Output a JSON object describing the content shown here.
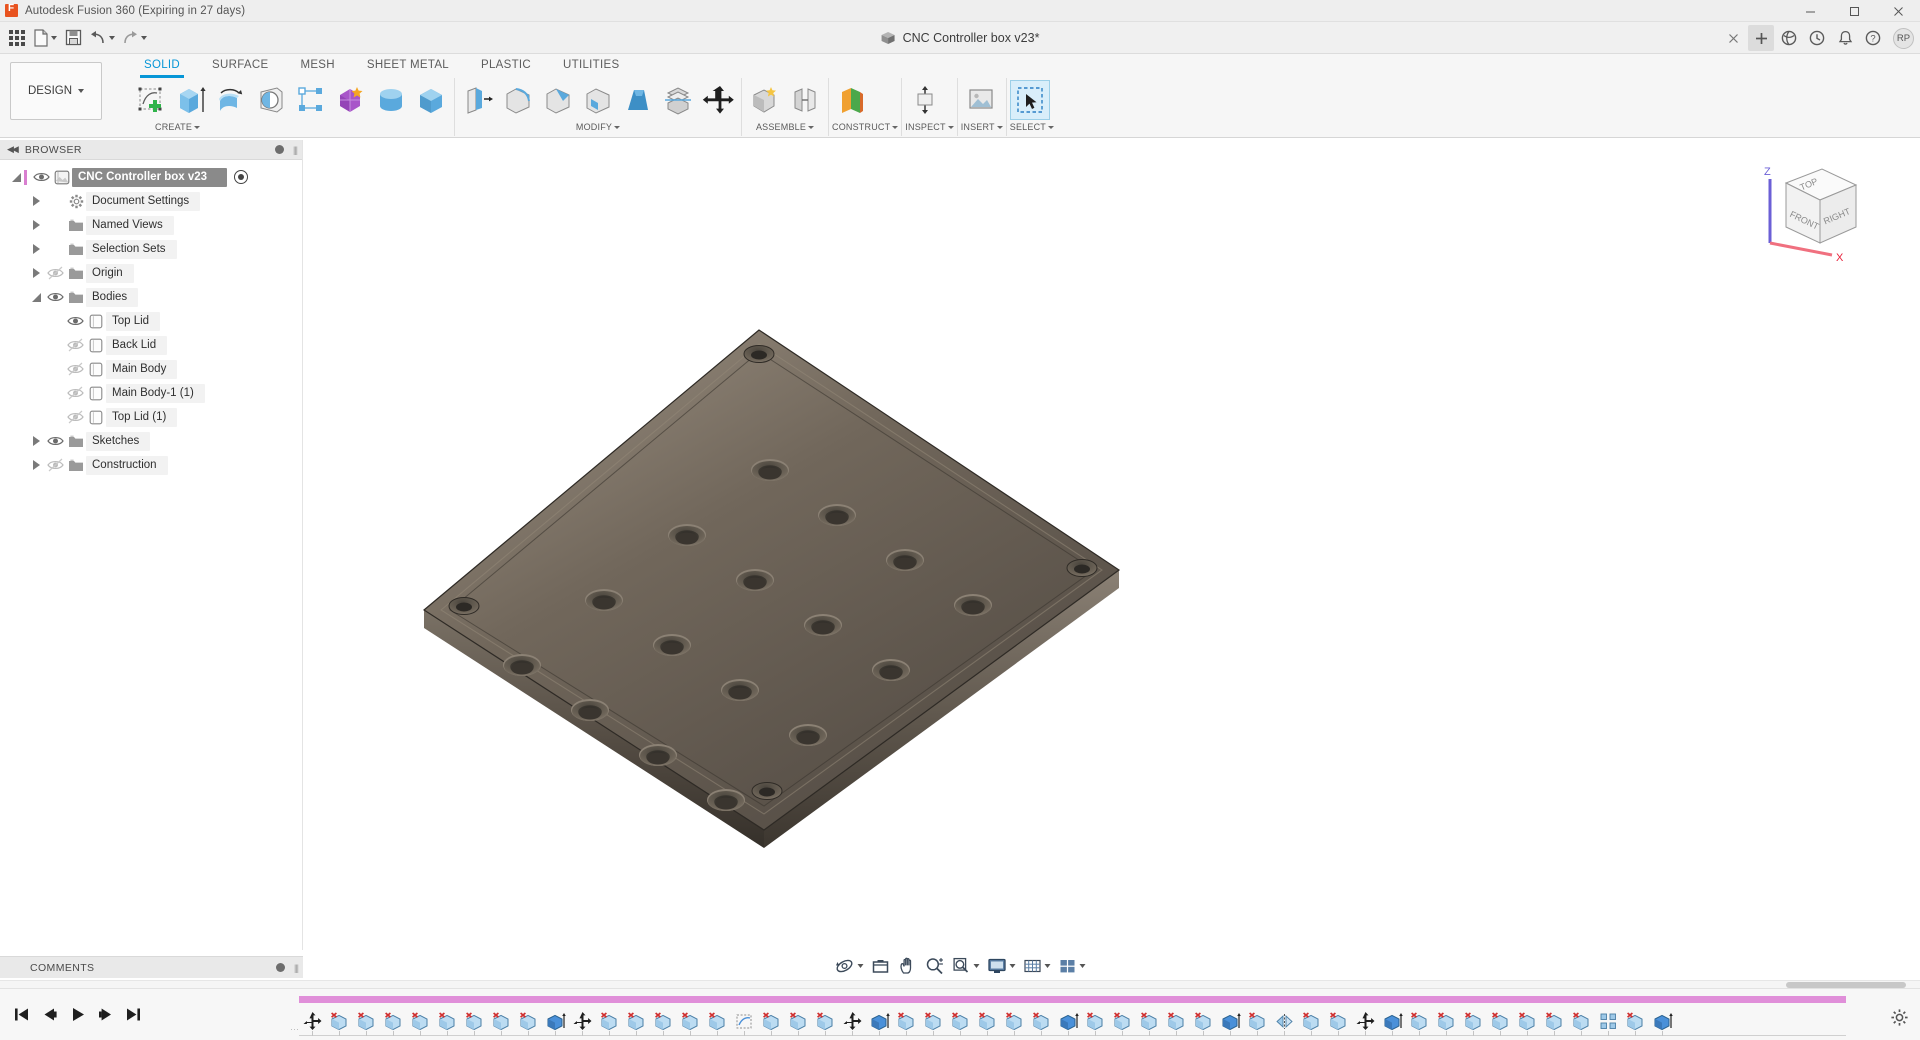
{
  "titlebar": {
    "app_title": "Autodesk Fusion 360 (Expiring in 27 days)",
    "logo_letter": "F",
    "minimize": "—",
    "maximize": "❐",
    "close": "✕"
  },
  "quick_access": {
    "items": [
      {
        "name": "app-grid-button",
        "label": ""
      },
      {
        "name": "file-menu-button",
        "label": ""
      },
      {
        "name": "save-button",
        "label": ""
      },
      {
        "name": "undo-button",
        "label": ""
      },
      {
        "name": "redo-button",
        "label": ""
      }
    ]
  },
  "document_tab": {
    "title": "CNC Controller box v23*",
    "close_label": "✕",
    "new_tab_label": "+"
  },
  "tab_right_icons": [
    {
      "name": "globe-icon",
      "glyph": "◔"
    },
    {
      "name": "clock-icon",
      "glyph": "◴"
    },
    {
      "name": "bell-icon",
      "glyph": "🔔"
    },
    {
      "name": "help-icon",
      "glyph": "?"
    }
  ],
  "user": {
    "initials": "RP"
  },
  "ribbon": {
    "workspace_label": "DESIGN",
    "tabs": [
      {
        "label": "SOLID",
        "active": true
      },
      {
        "label": "SURFACE",
        "active": false
      },
      {
        "label": "MESH",
        "active": false
      },
      {
        "label": "SHEET METAL",
        "active": false
      },
      {
        "label": "PLASTIC",
        "active": false
      },
      {
        "label": "UTILITIES",
        "active": false
      }
    ],
    "panels": [
      {
        "label": "CREATE",
        "has_caret": true,
        "tools": [
          {
            "name": "create-sketch-tool"
          },
          {
            "name": "extrude-tool"
          },
          {
            "name": "revolve-tool"
          },
          {
            "name": "sweep-tool"
          },
          {
            "name": "pattern-tool"
          },
          {
            "name": "form-tool"
          },
          {
            "name": "cylinder-primitive-tool"
          },
          {
            "name": "box-primitive-tool"
          }
        ]
      },
      {
        "label": "MODIFY",
        "has_caret": true,
        "tools": [
          {
            "name": "press-pull-tool"
          },
          {
            "name": "fillet-tool"
          },
          {
            "name": "chamfer-tool"
          },
          {
            "name": "shell-tool"
          },
          {
            "name": "draft-tool"
          },
          {
            "name": "split-body-tool"
          },
          {
            "name": "move-copy-tool"
          }
        ]
      },
      {
        "label": "ASSEMBLE",
        "has_caret": true,
        "tools": [
          {
            "name": "new-component-tool"
          },
          {
            "name": "joint-tool"
          }
        ]
      },
      {
        "label": "CONSTRUCT",
        "has_caret": true,
        "tools": [
          {
            "name": "construction-plane-tool"
          }
        ]
      },
      {
        "label": "INSPECT",
        "has_caret": true,
        "tools": [
          {
            "name": "measure-tool"
          }
        ]
      },
      {
        "label": "INSERT",
        "has_caret": true,
        "tools": [
          {
            "name": "insert-mcmaster-tool"
          }
        ]
      },
      {
        "label": "SELECT",
        "has_caret": true,
        "tools": [
          {
            "name": "select-tool"
          }
        ]
      }
    ]
  },
  "browser": {
    "header": "BROWSER",
    "tree": [
      {
        "label": "CNC Controller box v23",
        "level": 0,
        "expander": "down",
        "eye": "on",
        "icon": "component-icon",
        "root": true
      },
      {
        "label": "Document Settings",
        "level": 1,
        "expander": "right",
        "eye": "none",
        "icon": "gear-icon"
      },
      {
        "label": "Named Views",
        "level": 1,
        "expander": "right",
        "eye": "none",
        "icon": "folder-icon"
      },
      {
        "label": "Selection Sets",
        "level": 1,
        "expander": "right",
        "eye": "none",
        "icon": "folder-icon"
      },
      {
        "label": "Origin",
        "level": 1,
        "expander": "right",
        "eye": "off",
        "icon": "folder-icon"
      },
      {
        "label": "Bodies",
        "level": 1,
        "expander": "down",
        "eye": "on",
        "icon": "folder-icon"
      },
      {
        "label": "Top Lid",
        "level": 2,
        "expander": "none",
        "eye": "on",
        "icon": "body-icon"
      },
      {
        "label": "Back Lid",
        "level": 2,
        "expander": "none",
        "eye": "off",
        "icon": "body-icon"
      },
      {
        "label": "Main Body",
        "level": 2,
        "expander": "none",
        "eye": "off",
        "icon": "body-icon"
      },
      {
        "label": "Main Body-1 (1)",
        "level": 2,
        "expander": "none",
        "eye": "off",
        "icon": "body-icon"
      },
      {
        "label": "Top Lid (1)",
        "level": 2,
        "expander": "none",
        "eye": "off",
        "icon": "body-icon"
      },
      {
        "label": "Sketches",
        "level": 1,
        "expander": "right",
        "eye": "on",
        "icon": "folder-icon"
      },
      {
        "label": "Construction",
        "level": 1,
        "expander": "right",
        "eye": "off",
        "icon": "folder-icon"
      }
    ]
  },
  "viewcube": {
    "face_top": "TOP",
    "face_front": "FRONT",
    "face_right": "RIGHT",
    "axis_x": "X",
    "axis_z": "Z",
    "axis_x_color": "#e8223c",
    "axis_z_color": "#5b4fd0"
  },
  "comments": {
    "header": "COMMENTS"
  },
  "navbar": {
    "buttons": [
      {
        "name": "orbit-tool-button",
        "caret": true
      },
      {
        "name": "look-at-button",
        "caret": false
      },
      {
        "name": "pan-tool-button",
        "caret": false
      },
      {
        "name": "zoom-tool-button",
        "caret": false
      },
      {
        "name": "zoom-window-button",
        "caret": true
      },
      {
        "name": "display-settings-button",
        "caret": true
      },
      {
        "name": "grid-snaps-button",
        "caret": true
      },
      {
        "name": "viewport-layout-button",
        "caret": true
      }
    ]
  },
  "timeline": {
    "playback": [
      {
        "name": "go-to-beginning-button"
      },
      {
        "name": "step-back-button"
      },
      {
        "name": "play-button"
      },
      {
        "name": "step-forward-button"
      },
      {
        "name": "go-to-end-button"
      }
    ],
    "progress_color": "#e08fd9",
    "features": [
      {
        "name": "timeline-marker",
        "type": "marker"
      },
      {
        "name": "timeline-feature-extrude-cut",
        "type": "extrude-cut"
      },
      {
        "name": "timeline-feature-extrude-cut",
        "type": "extrude-cut"
      },
      {
        "name": "timeline-feature-extrude-cut",
        "type": "extrude-cut"
      },
      {
        "name": "timeline-feature-extrude-cut",
        "type": "extrude-cut"
      },
      {
        "name": "timeline-feature-extrude-cut",
        "type": "extrude-cut"
      },
      {
        "name": "timeline-feature-extrude-cut",
        "type": "extrude-cut"
      },
      {
        "name": "timeline-feature-extrude-cut",
        "type": "extrude-cut"
      },
      {
        "name": "timeline-feature-extrude-cut",
        "type": "extrude-cut"
      },
      {
        "name": "timeline-feature-extrude",
        "type": "extrude"
      },
      {
        "name": "timeline-feature-move",
        "type": "move"
      },
      {
        "name": "timeline-feature-extrude-cut",
        "type": "extrude-cut"
      },
      {
        "name": "timeline-feature-extrude-cut",
        "type": "extrude-cut"
      },
      {
        "name": "timeline-feature-extrude-cut",
        "type": "extrude-cut"
      },
      {
        "name": "timeline-feature-extrude-cut",
        "type": "extrude-cut"
      },
      {
        "name": "timeline-feature-extrude-cut",
        "type": "extrude-cut"
      },
      {
        "name": "timeline-feature-sketch",
        "type": "sketch"
      },
      {
        "name": "timeline-feature-extrude-cut",
        "type": "extrude-cut"
      },
      {
        "name": "timeline-feature-extrude-cut",
        "type": "extrude-cut"
      },
      {
        "name": "timeline-feature-extrude-cut",
        "type": "extrude-cut"
      },
      {
        "name": "timeline-feature-move",
        "type": "move"
      },
      {
        "name": "timeline-feature-extrude",
        "type": "extrude"
      },
      {
        "name": "timeline-feature-extrude-cut",
        "type": "extrude-cut"
      },
      {
        "name": "timeline-feature-extrude-cut",
        "type": "extrude-cut"
      },
      {
        "name": "timeline-feature-extrude-cut",
        "type": "extrude-cut"
      },
      {
        "name": "timeline-feature-extrude-cut",
        "type": "extrude-cut"
      },
      {
        "name": "timeline-feature-extrude-cut",
        "type": "extrude-cut"
      },
      {
        "name": "timeline-feature-extrude-cut",
        "type": "extrude-cut"
      },
      {
        "name": "timeline-feature-extrude",
        "type": "extrude"
      },
      {
        "name": "timeline-feature-extrude-cut",
        "type": "extrude-cut"
      },
      {
        "name": "timeline-feature-extrude-cut",
        "type": "extrude-cut"
      },
      {
        "name": "timeline-feature-extrude-cut",
        "type": "extrude-cut"
      },
      {
        "name": "timeline-feature-extrude-cut",
        "type": "extrude-cut"
      },
      {
        "name": "timeline-feature-extrude-cut",
        "type": "extrude-cut"
      },
      {
        "name": "timeline-feature-extrude",
        "type": "extrude"
      },
      {
        "name": "timeline-feature-extrude-cut",
        "type": "extrude-cut"
      },
      {
        "name": "timeline-feature-mirror",
        "type": "mirror"
      },
      {
        "name": "timeline-feature-extrude-cut",
        "type": "extrude-cut"
      },
      {
        "name": "timeline-feature-extrude-cut",
        "type": "extrude-cut"
      },
      {
        "name": "timeline-feature-move",
        "type": "move"
      },
      {
        "name": "timeline-feature-extrude",
        "type": "extrude"
      },
      {
        "name": "timeline-feature-extrude-cut",
        "type": "extrude-cut"
      },
      {
        "name": "timeline-feature-extrude-cut",
        "type": "extrude-cut"
      },
      {
        "name": "timeline-feature-extrude-cut",
        "type": "extrude-cut"
      },
      {
        "name": "timeline-feature-extrude-cut",
        "type": "extrude-cut"
      },
      {
        "name": "timeline-feature-extrude-cut",
        "type": "extrude-cut"
      },
      {
        "name": "timeline-feature-extrude-cut",
        "type": "extrude-cut"
      },
      {
        "name": "timeline-feature-extrude-cut",
        "type": "extrude-cut"
      },
      {
        "name": "timeline-feature-pattern",
        "type": "pattern"
      },
      {
        "name": "timeline-feature-extrude-cut",
        "type": "extrude-cut"
      },
      {
        "name": "timeline-feature-extrude",
        "type": "extrude"
      }
    ],
    "settings_button": "timeline-settings-button"
  },
  "model": {
    "name": "top-lid-plate",
    "body_color": "#6b6256",
    "hole_count": 16,
    "corner_hole_count": 4
  }
}
